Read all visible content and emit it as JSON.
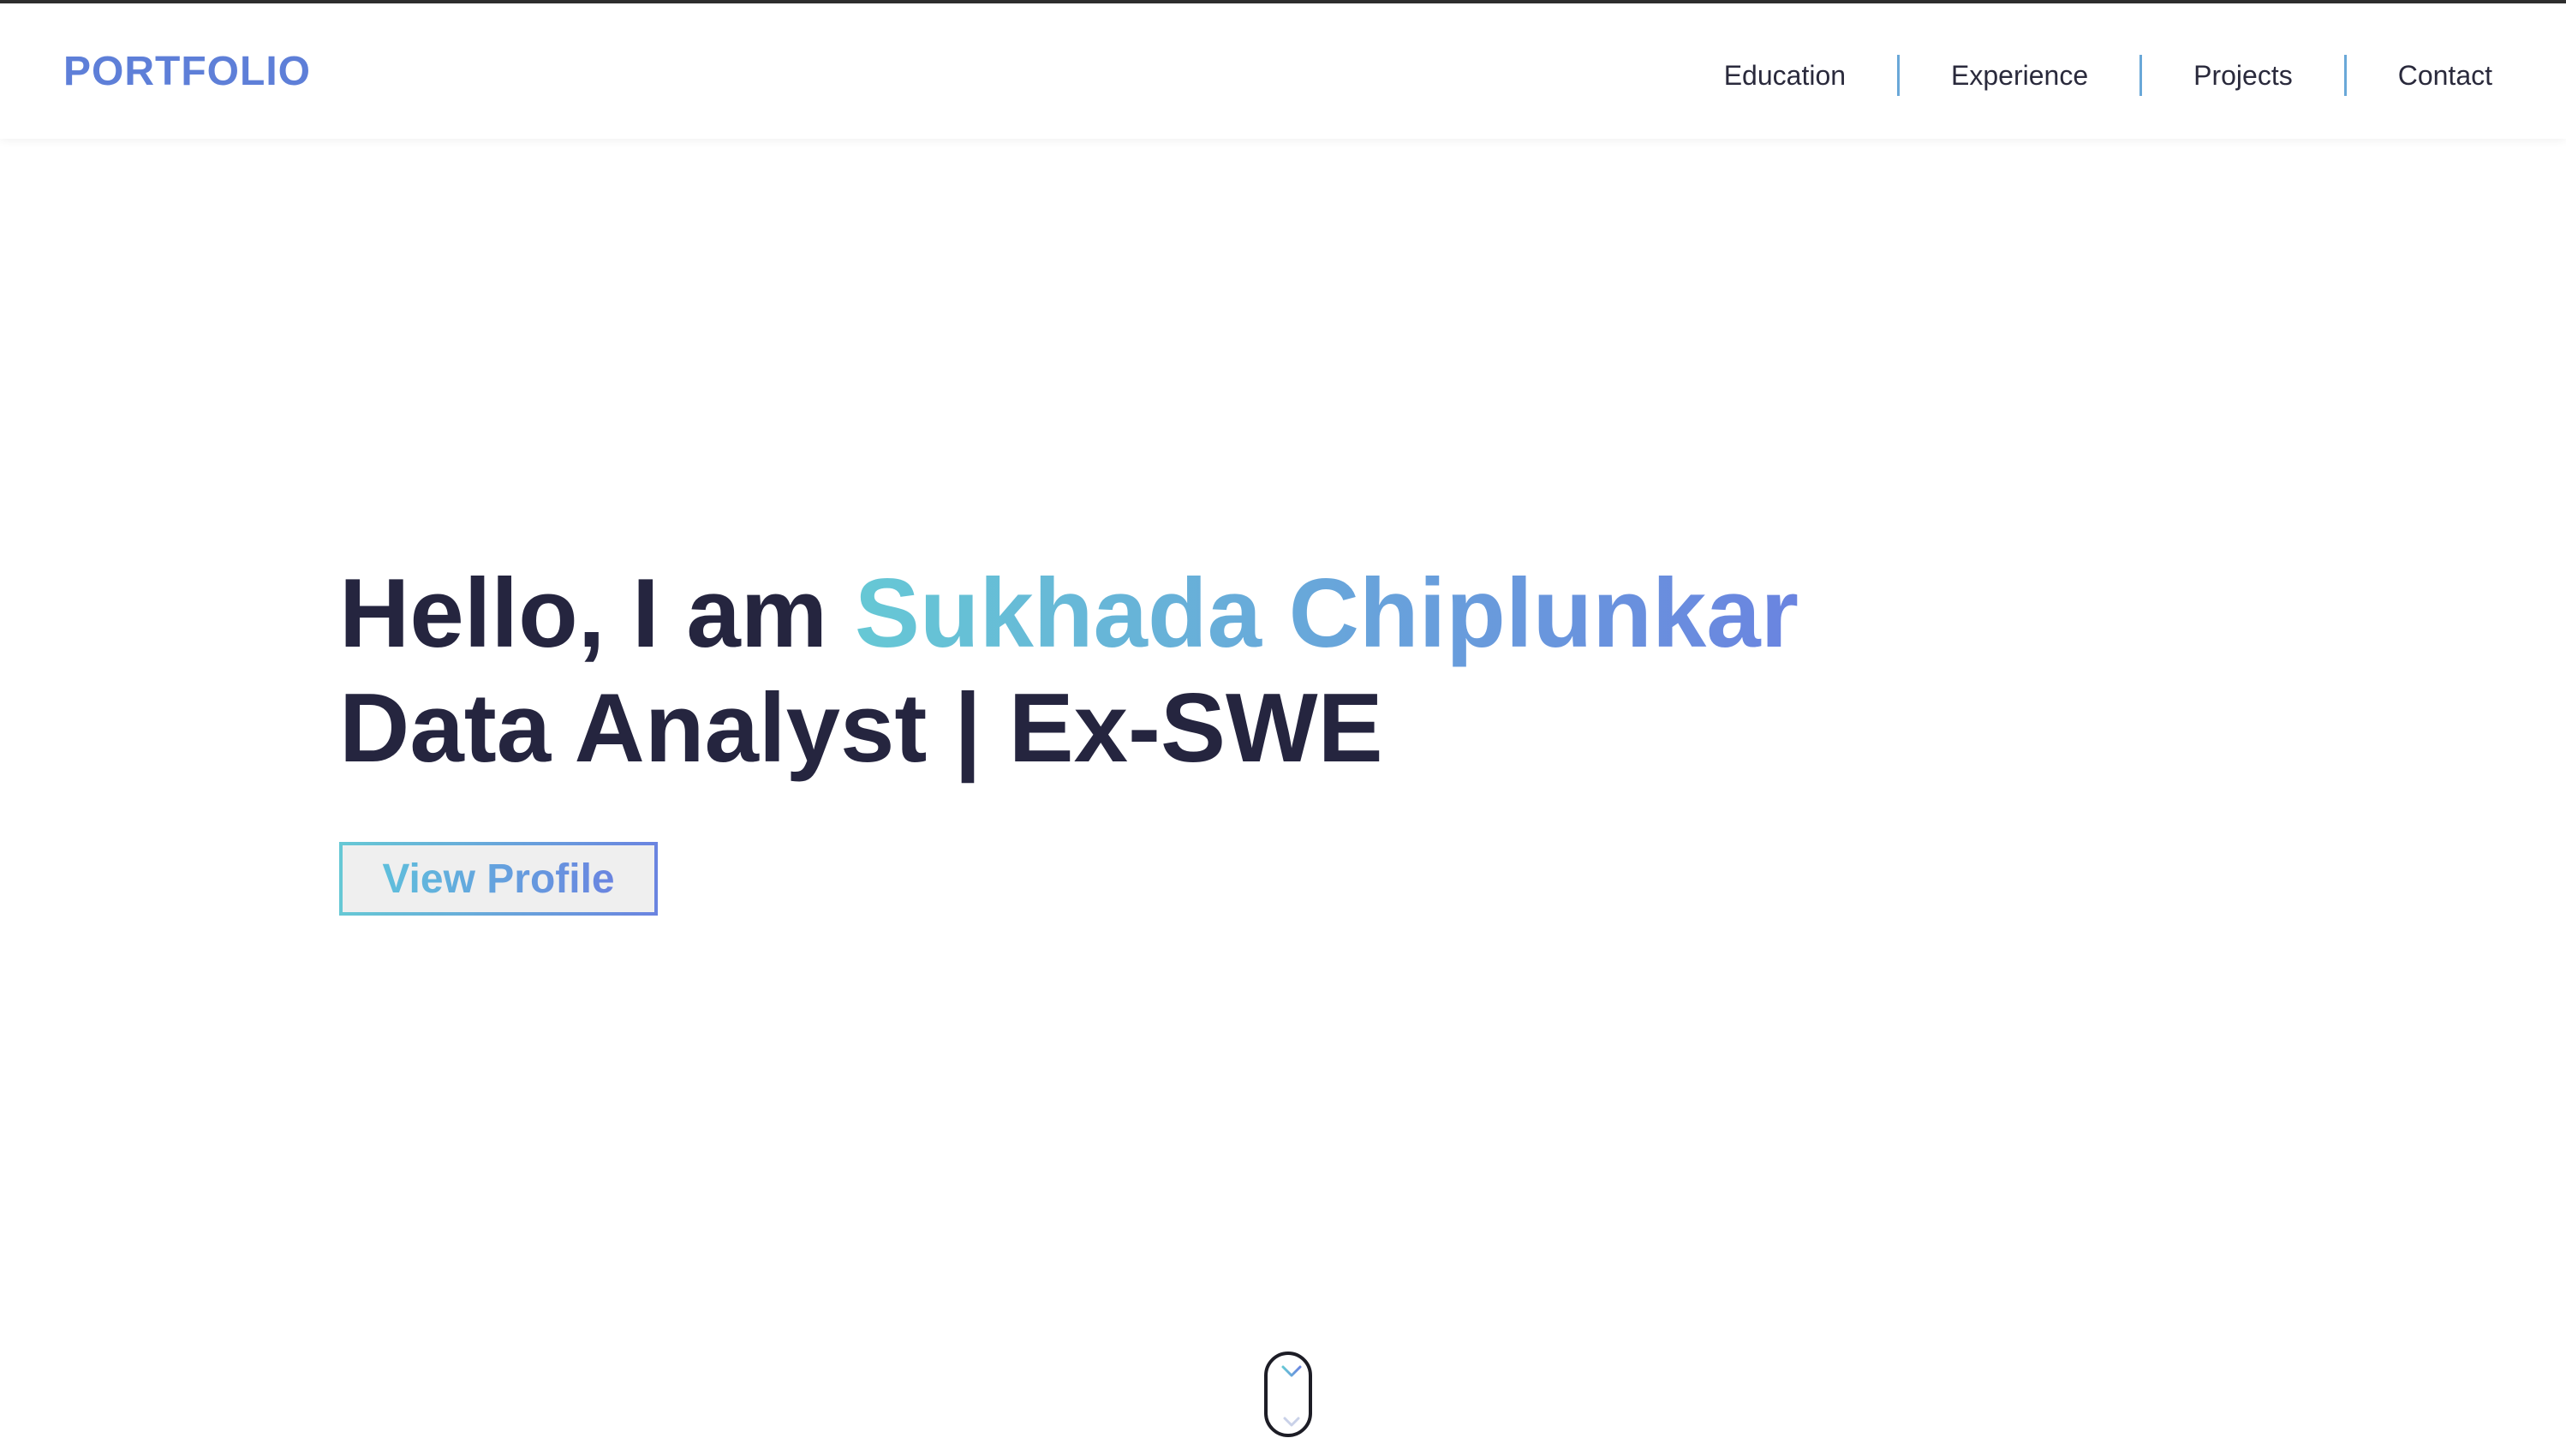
{
  "header": {
    "logo": "PORTFOLIO",
    "nav": [
      "Education",
      "Experience",
      "Projects",
      "Contact"
    ]
  },
  "hero": {
    "greeting": "Hello, I am ",
    "name": "Sukhada Chiplunkar",
    "subtitle": "Data Analyst | Ex-SWE",
    "button": "View Profile"
  },
  "icons": {
    "scroll": "scroll-down-mouse-icon"
  },
  "colors": {
    "accent_start": "#66c8d5",
    "accent_end": "#6a84e0",
    "text_dark": "#25253f",
    "nav_separator": "#6aa8d8"
  }
}
